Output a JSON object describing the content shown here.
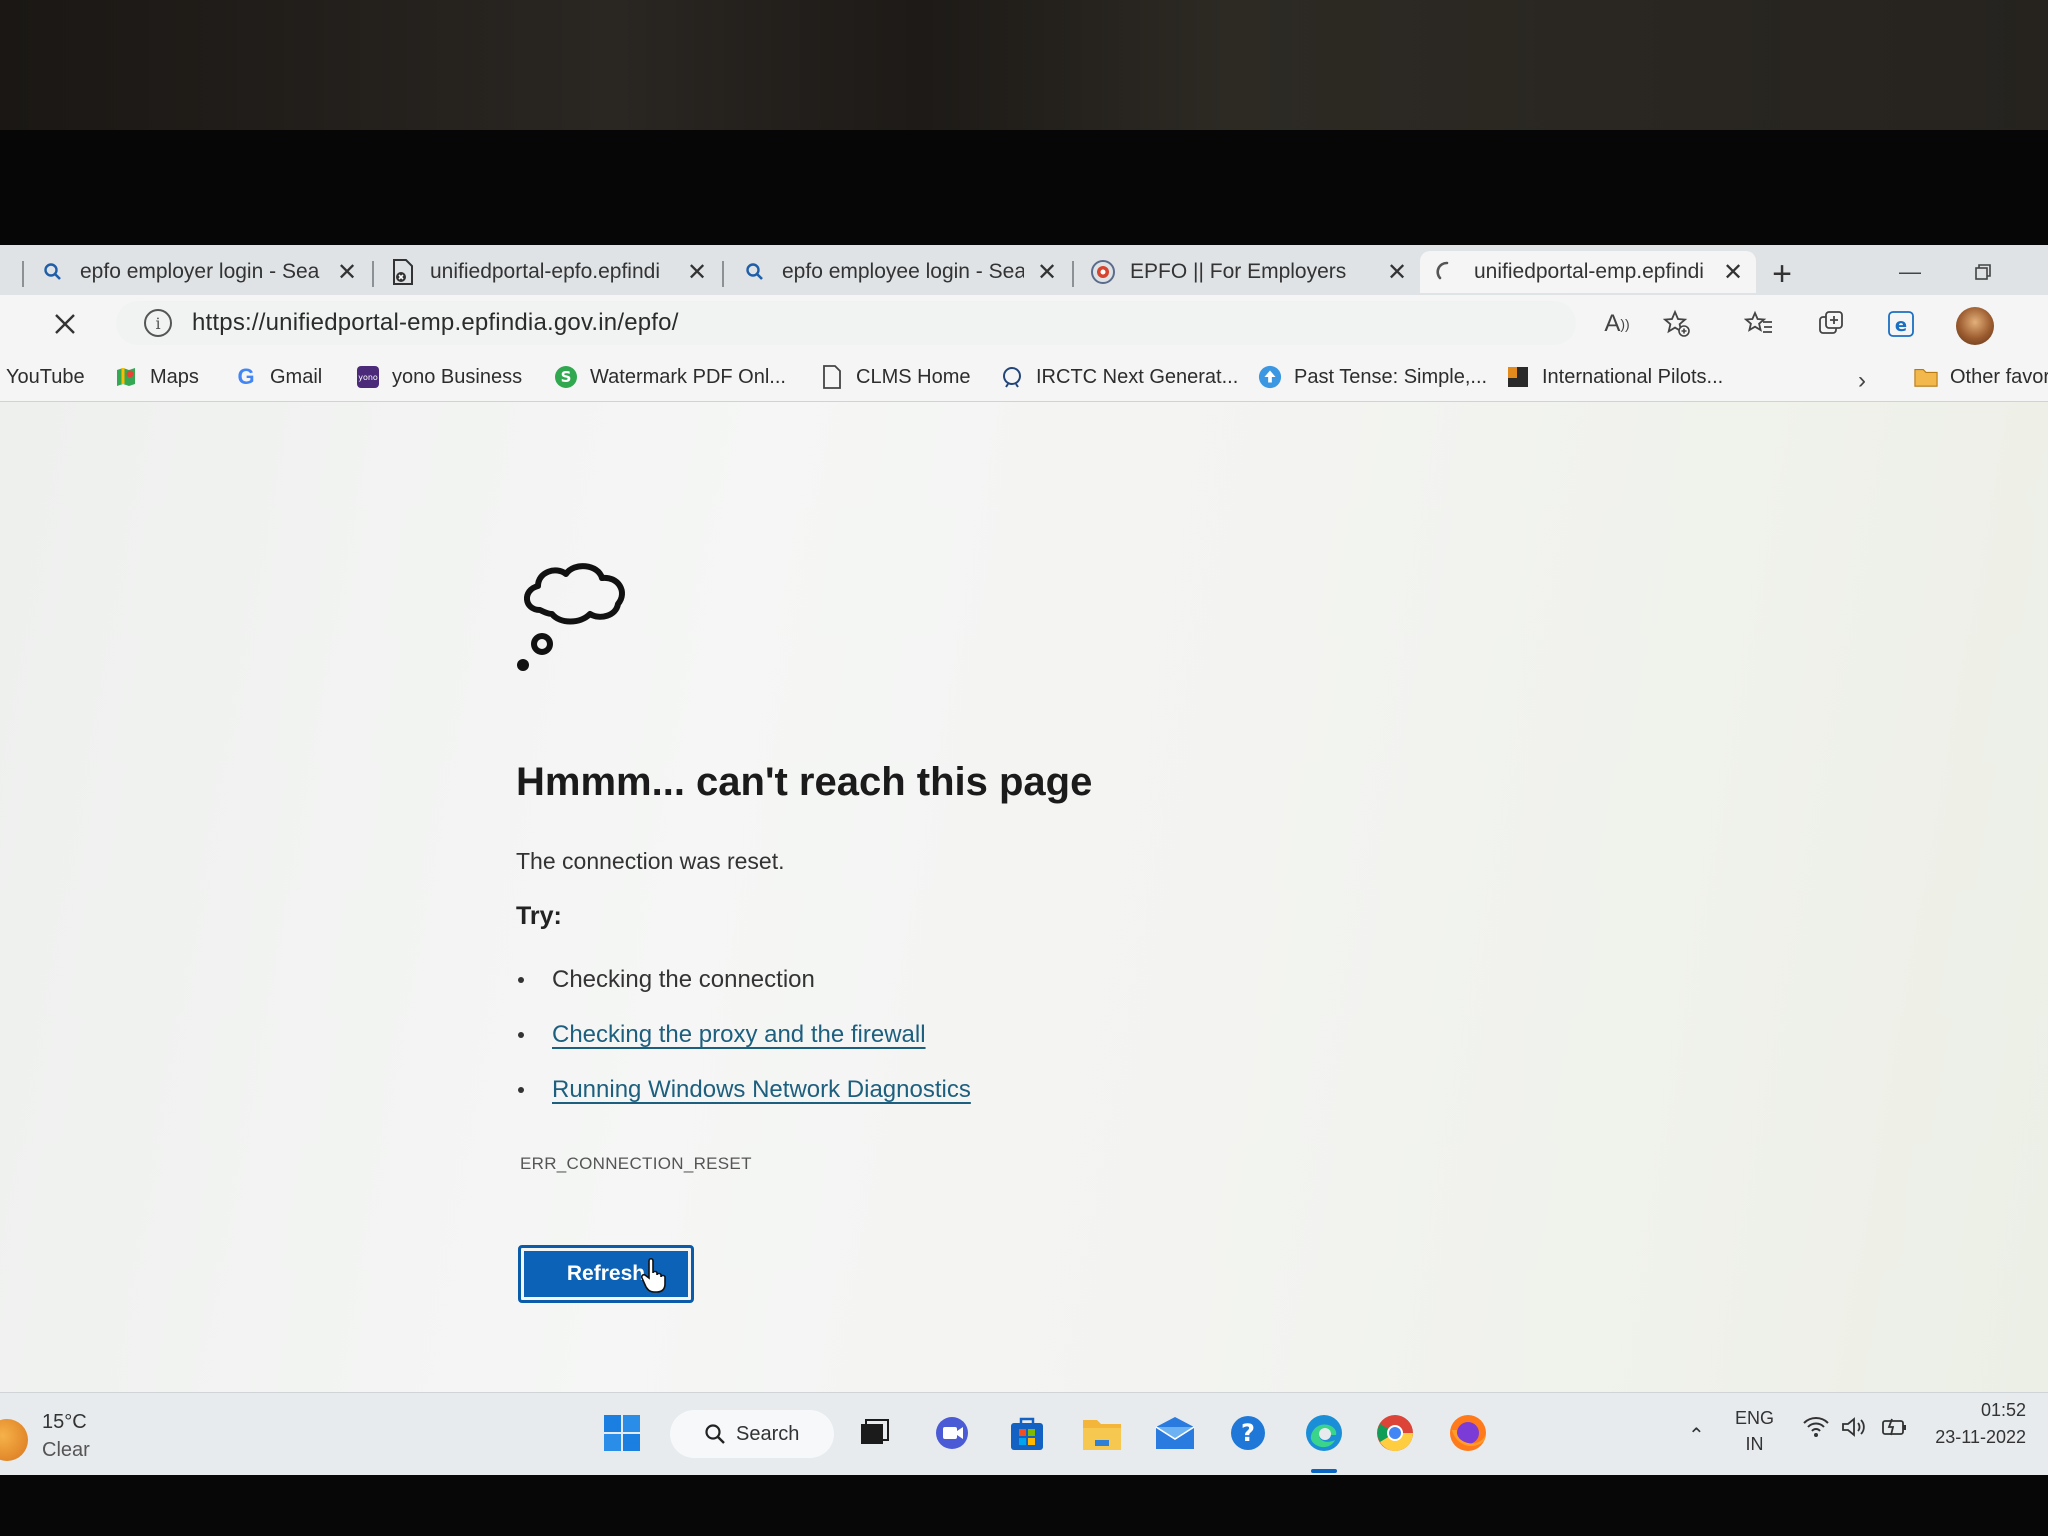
{
  "browser": {
    "tabs": [
      {
        "label": "epfo employer login - Sea",
        "icon": "search-icon",
        "active": false
      },
      {
        "label": "unifiedportal-epfo.epfindi",
        "icon": "error-page-icon",
        "active": false
      },
      {
        "label": "epfo employee login - Sea",
        "icon": "search-icon",
        "active": false
      },
      {
        "label": "EPFO || For Employers",
        "icon": "epfo-logo-icon",
        "active": false
      },
      {
        "label": "unifiedportal-emp.epfindi",
        "icon": "loading-spinner-icon",
        "active": true
      }
    ],
    "url": "https://unifiedportal-emp.epfindia.gov.in/epfo/",
    "read_aloud_label": "A",
    "bookmarks": [
      {
        "label": "YouTube",
        "icon": ""
      },
      {
        "label": "Maps",
        "icon": "maps-icon"
      },
      {
        "label": "Gmail",
        "icon": "google-icon"
      },
      {
        "label": "yono Business",
        "icon": "yono-icon"
      },
      {
        "label": "Watermark PDF Onl...",
        "icon": "watermark-s-icon"
      },
      {
        "label": "CLMS Home",
        "icon": "page-icon"
      },
      {
        "label": "IRCTC Next Generat...",
        "icon": "irctc-icon"
      },
      {
        "label": "Past Tense: Simple,...",
        "icon": "upload-arrow-icon"
      },
      {
        "label": "International Pilots...",
        "icon": "pilots-icon"
      }
    ],
    "other_favorites": "Other favor"
  },
  "error_page": {
    "title": "Hmmm... can't reach this page",
    "description": "The connection was reset.",
    "try_label": "Try:",
    "suggestions": [
      {
        "text": "Checking the connection",
        "is_link": false
      },
      {
        "text": "Checking the proxy and the firewall",
        "is_link": true
      },
      {
        "text": "Running Windows Network Diagnostics",
        "is_link": true
      }
    ],
    "error_code": "ERR_CONNECTION_RESET",
    "refresh_label": "Refresh"
  },
  "taskbar": {
    "weather_temp": "15°C",
    "weather_condition": "Clear",
    "search_label": "Search",
    "language_line1": "ENG",
    "language_line2": "IN",
    "time": "01:52",
    "date": "23-11-2022"
  },
  "colors": {
    "link": "#1d5f7e",
    "button": "#0b62b7",
    "tabstrip": "#dfe3e6"
  }
}
